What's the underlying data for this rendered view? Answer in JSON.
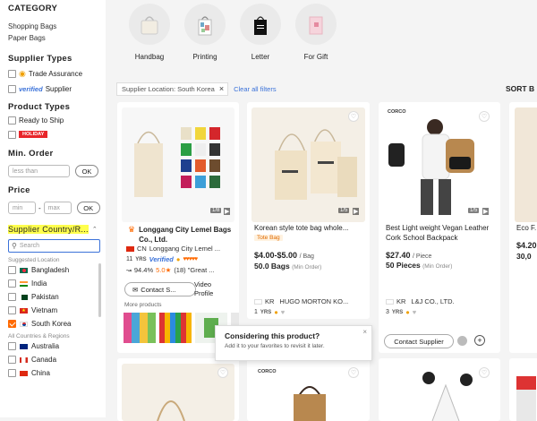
{
  "sidebar": {
    "category_title": "CATEGORY",
    "categories": [
      "Shopping Bags",
      "Paper Bags"
    ],
    "supplier_types_title": "Supplier Types",
    "trade_assurance": "Trade Assurance",
    "verified_badge": "verified",
    "verified_supplier": "Supplier",
    "product_types_title": "Product Types",
    "ready_to_ship": "Ready to Ship",
    "holiday_badge": "HOLIDAY",
    "min_order_title": "Min. Order",
    "min_order_placeholder": "less than",
    "ok_label": "OK",
    "price_title": "Price",
    "price_min_placeholder": "min",
    "price_max_placeholder": "max",
    "price_dash": "-",
    "supplier_country_title": "Supplier Country/R...",
    "search_placeholder": "Search",
    "suggested_location_label": "Suggested Location",
    "suggested_countries": [
      {
        "name": "Bangladesh",
        "checked": false
      },
      {
        "name": "India",
        "checked": false
      },
      {
        "name": "Pakistan",
        "checked": false
      },
      {
        "name": "Vietnam",
        "checked": false
      },
      {
        "name": "South Korea",
        "checked": true
      }
    ],
    "all_countries_label": "All Countries & Regions",
    "all_countries": [
      {
        "name": "Australia",
        "checked": false
      },
      {
        "name": "Canada",
        "checked": false
      },
      {
        "name": "China",
        "checked": false
      }
    ]
  },
  "top_categories": [
    {
      "label": "Handbag"
    },
    {
      "label": "Printing"
    },
    {
      "label": "Letter"
    },
    {
      "label": "For Gift"
    }
  ],
  "filter_bar": {
    "chip_label": "Supplier Location: South Korea",
    "chip_close": "×",
    "clear_all": "Clear all filters",
    "sort_by": "SORT B"
  },
  "cards": [
    {
      "pic_count": "1/8",
      "title": "Longgang City Lemel Bags Co., Ltd.",
      "country": "CN",
      "supplier": "Longgang City Lemel ...",
      "years": "11",
      "yrs_label": "YRS",
      "verified": "Verified",
      "response": "94.4%",
      "rating": "5.0★",
      "reviews": "(18) \"Great ...",
      "contact_label": "Contact S...",
      "video_profile": "Video Profile",
      "more_products": "More products"
    },
    {
      "pic_count": "1/5",
      "title": "Korean style tote bag whole...",
      "tag": "Tote Bag",
      "price": "$4.00-$5.00",
      "price_unit": "/ Bag",
      "moq": "50.0 Bags",
      "moq_label": "(Min Order)",
      "country": "KR",
      "supplier": "HUGO MORTON KO...",
      "years": "1",
      "yrs_label": "YRS"
    },
    {
      "pic_count": "1/5",
      "brand": "CORCO",
      "title": "Best Light weight Vegan Leather Cork School Backpack",
      "price": "$27.40",
      "price_unit": "/ Piece",
      "moq": "50 Pieces",
      "moq_label": "(Min Order)",
      "country": "KR",
      "supplier": "L&J CO., LTD.",
      "years": "3",
      "yrs_label": "YRS",
      "contact_label": "Contact Supplier"
    },
    {
      "title": "Eco F...",
      "price": "$4.20",
      "moq": "30,0"
    }
  ],
  "bottom_cards": [
    {
      "brand": ""
    },
    {
      "brand": "CORCO"
    },
    {
      "brand": ""
    },
    {
      "brand": ""
    }
  ],
  "popup": {
    "title": "Considering this product?",
    "text": "Add it to your favorites to revisit it later.",
    "close": "×"
  },
  "colors": {
    "accent_orange": "#ff6a00",
    "link_blue": "#3b72d9",
    "highlight": "#ffff4d"
  }
}
